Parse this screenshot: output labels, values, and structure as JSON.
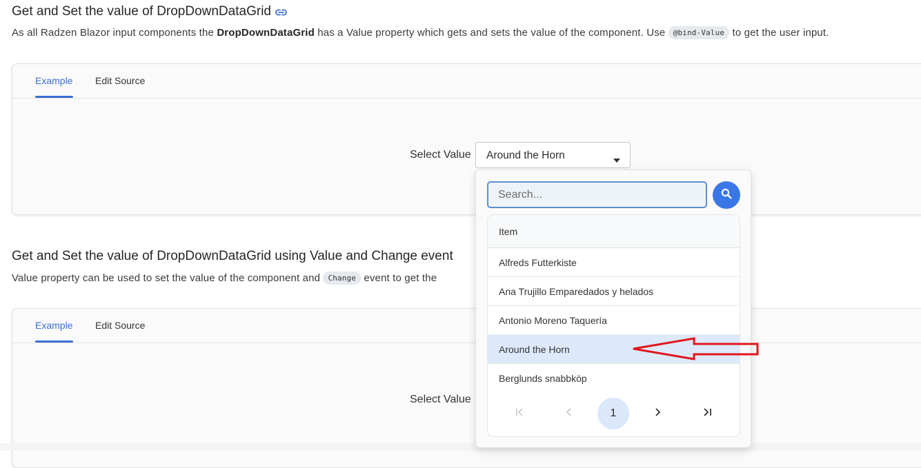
{
  "section1": {
    "title": "Get and Set the value of DropDownDataGrid",
    "desc_pre": "As all Radzen Blazor input components the ",
    "desc_bold": "DropDownDataGrid",
    "desc_mid": " has a Value property which gets and sets the value of the component. Use ",
    "desc_code": "@bind-Value",
    "desc_post": " to get the user input."
  },
  "section2": {
    "title": "Get and Set the value of DropDownDataGrid using Value and Change event",
    "desc_pre": "Value property can be used to set the value of the component and ",
    "desc_code": "Change",
    "desc_post": " event to get the"
  },
  "tabs": {
    "example": "Example",
    "edit_source": "Edit Source"
  },
  "select_label": "Select Value",
  "dropdown": {
    "selected_value": "Around the Horn"
  },
  "popup": {
    "search_placeholder": "Search...",
    "column_header": "Item",
    "rows": [
      "Alfreds Futterkiste",
      "Ana Trujillo Emparedados y helados",
      "Antonio Moreno Taquería",
      "Around the Horn",
      "Berglunds snabbköp"
    ],
    "selected_index": 3,
    "current_page": "1"
  },
  "colors": {
    "accent": "#3b6fd6",
    "selected_row": "#dde9fb",
    "arrow": "#e0161c"
  },
  "icons": {
    "link": "link-icon",
    "search": "search-icon",
    "caret": "caret-down-icon",
    "first": "first-page-icon",
    "prev": "prev-page-icon",
    "next": "next-page-icon",
    "last": "last-page-icon"
  }
}
